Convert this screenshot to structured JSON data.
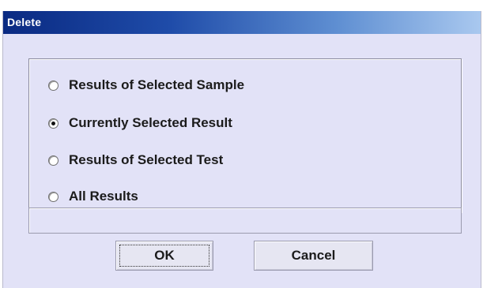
{
  "window": {
    "title": "Delete"
  },
  "options": [
    {
      "label": "Results of Selected Sample",
      "selected": false
    },
    {
      "label": "Currently Selected Result",
      "selected": true
    },
    {
      "label": "Results of Selected Test",
      "selected": false
    },
    {
      "label": "All Results",
      "selected": false
    }
  ],
  "status_field": {
    "value": ""
  },
  "buttons": {
    "ok_label": "OK",
    "cancel_label": "Cancel"
  },
  "colors": {
    "dialog_background": "#e2e2f7",
    "titlebar_start": "#0a2a82",
    "titlebar_end": "#a9c8ef"
  }
}
